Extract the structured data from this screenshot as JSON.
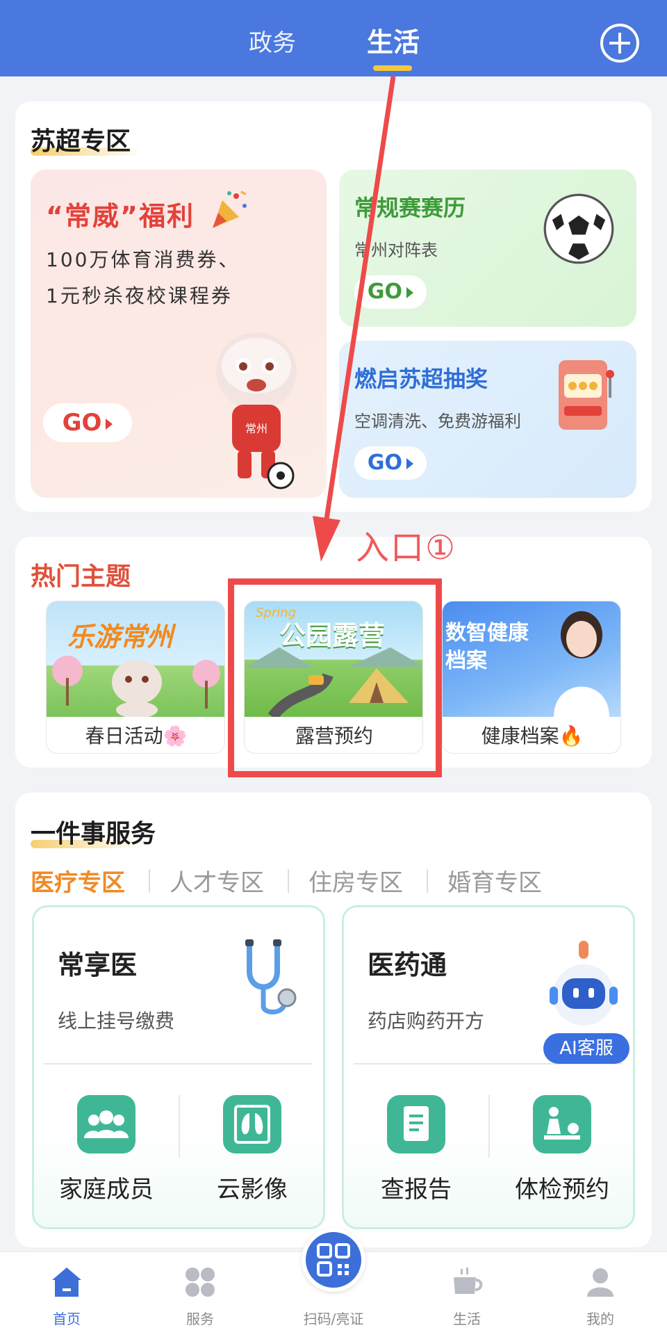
{
  "header": {
    "tabs": [
      {
        "label": "政务",
        "active": false
      },
      {
        "label": "生活",
        "active": true
      }
    ],
    "plus_icon": "plus-circle-icon"
  },
  "su_chao": {
    "title": "苏超专区",
    "big_promo": {
      "title": "“常威”福利",
      "line1": "100万体育消费券、",
      "line2": "1元秒杀夜校课程券",
      "go": "GO",
      "mascot_badge": "常州"
    },
    "schedule_promo": {
      "title": "常规赛赛历",
      "subtitle": "常州对阵表",
      "go": "GO"
    },
    "lottery_promo": {
      "title": "燃启苏超抽奖",
      "subtitle": "空调清洗、免费游福利",
      "go": "GO"
    }
  },
  "annotation": {
    "label": "入口①",
    "color": "#ee4a4a"
  },
  "hot_topics": {
    "title": "热门主题",
    "items": [
      {
        "banner": "乐游常州",
        "label": "春日活动🌸"
      },
      {
        "banner": "公园露营",
        "banner_tag": "Spring",
        "label": "露营预约"
      },
      {
        "banner": "数智健康档案",
        "label": "健康档案🔥"
      }
    ]
  },
  "services": {
    "title": "一件事服务",
    "tabs": [
      "医疗专区",
      "人才专区",
      "住房专区",
      "婚育专区"
    ],
    "active_tab": "医疗专区",
    "cards": [
      {
        "name": "常享医",
        "desc": "线上挂号缴费",
        "icon": "stethoscope-icon",
        "items": [
          {
            "label": "家庭成员",
            "icon": "family-icon"
          },
          {
            "label": "云影像",
            "icon": "lung-scan-icon"
          }
        ]
      },
      {
        "name": "医药通",
        "desc": "药店购药开方",
        "icon": "robot-icon",
        "items": [
          {
            "label": "查报告",
            "icon": "report-icon"
          },
          {
            "label": "体检预约",
            "icon": "checkup-icon"
          }
        ]
      }
    ],
    "ai_badge": "AI客服"
  },
  "bottom_nav": {
    "items": [
      {
        "label": "首页",
        "icon": "home-icon",
        "active": true
      },
      {
        "label": "服务",
        "icon": "grid-icon",
        "active": false
      },
      {
        "label": "扫码/亮证",
        "icon": "qr-code-icon",
        "active": false
      },
      {
        "label": "生活",
        "icon": "coffee-cup-icon",
        "active": false
      },
      {
        "label": "我的",
        "icon": "person-icon",
        "active": false
      }
    ]
  },
  "colors": {
    "header": "#4a78de",
    "accent_orange": "#f08a24",
    "accent_red": "#e2423a",
    "teal": "#3fb796",
    "nav_active": "#3d6fd9"
  }
}
